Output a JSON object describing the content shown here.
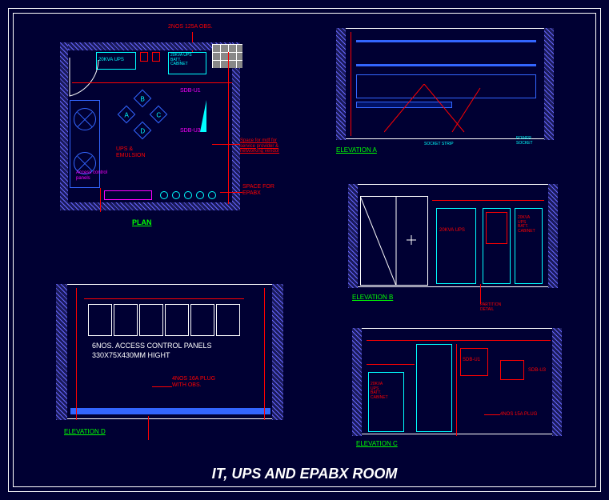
{
  "title": "IT, UPS AND EPABX ROOM",
  "plan": {
    "label": "PLAN",
    "note_top": "2NOS 125A OBS.",
    "ups_label": "20KVA UPS",
    "cabinet_label": "20KVA UPS\nBATT.\nCABINET",
    "sdb_u1": "SDB-U1",
    "sdb_u3": "SDB-U3",
    "ups_power": "UPS &\nEMULSION",
    "access_panel": "Access control\npanels",
    "mdf_note": "Space for mdf for\nservice provider &\nnetworking vender",
    "epabx_space": "SPACE FOR\nEPABX",
    "diamond_a": "A",
    "diamond_b": "B",
    "diamond_c": "C",
    "diamond_d": "D"
  },
  "elev_a": {
    "label": "ELEVATION A"
  },
  "elev_b": {
    "label": "ELEVATION B",
    "ups_label": "20KVA UPS",
    "cabinet_label": "20KVA\nUPS\nBATT.\nCABINET"
  },
  "elev_c": {
    "label": "ELEVATION C",
    "sdb_u1": "SDB-U1",
    "sdb_u3": "SDB-U3",
    "cabinet_label": "20KVA\nUPS\nBATT.\nCABINET",
    "plug_note": "4NOS 15A PLUG"
  },
  "elev_d": {
    "label": "ELEVATION D",
    "panel_text1": "6NOS. ACCESS CONTROL PANELS",
    "panel_text2": "330X75X430MM HIGHT",
    "plug_note": "4NOS 16A PLUG\nWITH OBS."
  }
}
